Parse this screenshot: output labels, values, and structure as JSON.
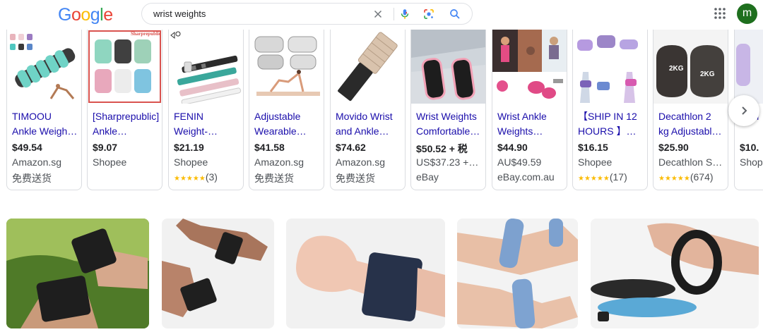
{
  "search": {
    "query": "wrist weights",
    "logo_letters": [
      "G",
      "o",
      "o",
      "g",
      "l",
      "e"
    ],
    "logo_colors": [
      "#4285f4",
      "#ea4335",
      "#fbbc05",
      "#4285f4",
      "#34a853",
      "#ea4335"
    ]
  },
  "account": {
    "avatar_letter": "m"
  },
  "products": [
    {
      "title1": "TIMOOU",
      "title2": "Ankle Weigh…",
      "price": "$49.54",
      "store": "Amazon.sg",
      "extra": "免费送货"
    },
    {
      "title1": "[Sharprepublic]",
      "title2": "Ankle…",
      "price": "$9.07",
      "store": "Shopee",
      "extra": "",
      "thumb_text": "Sharprepublic"
    },
    {
      "title1": "FENIN",
      "title2": "Weight-…",
      "price": "$21.19",
      "store": "Shopee",
      "extra": "",
      "stars": "★★★★★",
      "rating_count": "(3)"
    },
    {
      "title1": "Adjustable",
      "title2": "Wearable…",
      "price": "$41.58",
      "store": "Amazon.sg",
      "extra": "免费送货"
    },
    {
      "title1": "Movido Wrist",
      "title2": "and Ankle…",
      "price": "$74.62",
      "store": "Amazon.sg",
      "extra": "免费送货"
    },
    {
      "title1": "Wrist Weights",
      "title2": "Comfortable…",
      "price": "$50.52 + 税",
      "store": "US$37.23 +…",
      "extra": "eBay"
    },
    {
      "title1": "Wrist Ankle",
      "title2": "Weights…",
      "price": "$44.90",
      "store": "AU$49.59",
      "extra": "eBay.com.au"
    },
    {
      "title1": "【SHIP IN 12",
      "title2": "HOURS 】…",
      "price": "$16.15",
      "store": "Shopee",
      "extra": "",
      "stars": "★★★★★",
      "rating_count": "(17)"
    },
    {
      "title1": "Decathlon 2",
      "title2": "kg Adjustabl…",
      "price": "$25.90",
      "store": "Decathlon S…",
      "extra": "",
      "stars": "★★★★★",
      "rating_count": "(674)",
      "thumb_text": "2KG"
    },
    {
      "title1": "",
      "title2": "Ankl",
      "price": "$10.",
      "store": "Shop",
      "extra": ""
    }
  ],
  "colors": {
    "link": "#1a0dab",
    "star": "#fbbc04",
    "avatar_bg": "#1e6f1e"
  }
}
